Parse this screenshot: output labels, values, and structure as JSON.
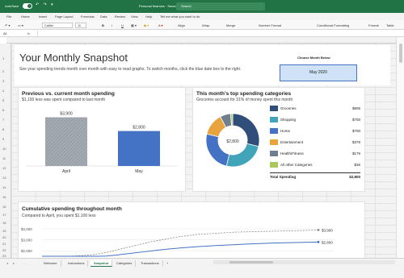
{
  "titlebar": {
    "autosave_label": "AutoSave",
    "autosave_state": "On",
    "doc_title": "Personal finances · Saved",
    "search_placeholder": "Search",
    "quick_access": "↶ ↷ ▾"
  },
  "menu": {
    "items": [
      "File",
      "Home",
      "Insert",
      "Page Layout",
      "Formulas",
      "Data",
      "Review",
      "View",
      "Help"
    ],
    "tell_me": "Tell me what you want to do"
  },
  "ribbon": {
    "font_name": "Calibri",
    "font_size": "11",
    "bold": "B",
    "italic": "I",
    "underline": "U",
    "align_label": "Align",
    "wrap_label": "Wrap",
    "merge_label": "Merge",
    "number_format": "Number Format",
    "cond_format": "Conditional Formatting",
    "format_label": "Format",
    "table_label": "Table"
  },
  "formula_bar": {
    "cell_ref": "A1",
    "fx": "fx",
    "value": ""
  },
  "row_numbers": [
    "1",
    "2",
    "3",
    "4",
    "5",
    "6",
    "7",
    "8",
    "9",
    "10",
    "11",
    "12",
    "13",
    "14",
    "15",
    "16",
    "17",
    "18",
    "19",
    "20",
    "21",
    "22",
    "23"
  ],
  "header": {
    "title": "Your Monthly Snapshot",
    "subtitle": "See your spending trends month over month with easy to read graphs. To switch months, click the blue date box to the right.",
    "choose_label": "Choose Month Below",
    "month_value": "May 2020"
  },
  "prev_vs_current": {
    "title": "Previous vs. current month spending",
    "subtitle": "$1,100 less was spent compared to last month"
  },
  "top_categories": {
    "title": "This month’s top spending categories",
    "subtitle": "Groceries account for 31% of money spent this month",
    "center_label": "$2,800",
    "total_label": "Total Spending",
    "total_value": "$2,800",
    "rows": [
      {
        "label": "Groceries",
        "value": "$806",
        "color": "#2f4e7a"
      },
      {
        "label": "Shopping",
        "value": "$700",
        "color": "#41a4b8"
      },
      {
        "label": "Home",
        "value": "$700",
        "color": "#4472c4"
      },
      {
        "label": "Entertainment",
        "value": "$379",
        "color": "#e8a33d"
      },
      {
        "label": "Health/Fitness",
        "value": "$179",
        "color": "#6f7f8f"
      },
      {
        "label": "All other Categories",
        "value": "$36",
        "color": "#a9c75a"
      }
    ]
  },
  "cumulative": {
    "title": "Cumulative spending throughout month",
    "subtitle": "Compared to April, you spent $1,100 less"
  },
  "chart_data": [
    {
      "type": "bar",
      "categories": [
        "April",
        "May"
      ],
      "values": [
        3900,
        2800
      ],
      "data_labels": [
        "$3,900",
        "$2,800"
      ],
      "ylim": [
        0,
        4000
      ]
    },
    {
      "type": "pie",
      "categories": [
        "Groceries",
        "Shopping",
        "Home",
        "Entertainment",
        "Health/Fitness",
        "All other Categories"
      ],
      "values": [
        806,
        700,
        700,
        379,
        179,
        36
      ],
      "center_label": "$2,800"
    },
    {
      "type": "line",
      "ytick_labels": [
        "$4,000",
        "$3,000",
        "$2,000"
      ],
      "ylim": [
        1500,
        4000
      ],
      "x": [
        0,
        1,
        2,
        3,
        4,
        5,
        6,
        7,
        8,
        9,
        10,
        11,
        12,
        13,
        14,
        15,
        16,
        17,
        18,
        19,
        20,
        21,
        22,
        23,
        24,
        25,
        26,
        27,
        28,
        29,
        30
      ],
      "series": [
        {
          "values": [
            1500,
            1500,
            1500,
            1500,
            1550,
            1600,
            1700,
            1850,
            2050,
            2250,
            2450,
            2650,
            2850,
            3000,
            3150,
            3300,
            3400,
            3500,
            3550,
            3600,
            3650,
            3700,
            3720,
            3740,
            3760,
            3780,
            3800,
            3820,
            3840,
            3870,
            3900
          ],
          "end_label": "$3,900",
          "style": "dashed",
          "color": "#8a8a8a"
        },
        {
          "values": [
            1500,
            1500,
            1500,
            1500,
            1500,
            1500,
            1500,
            1520,
            1600,
            1700,
            1800,
            1900,
            2000,
            2100,
            2180,
            2250,
            2320,
            2380,
            2430,
            2480,
            2520,
            2560,
            2600,
            2640,
            2670,
            2700,
            2720,
            2740,
            2760,
            2780,
            2800
          ],
          "end_label": "$2,800",
          "style": "solid",
          "color": "#4472c4"
        }
      ]
    }
  ],
  "sheet_tabs": [
    "Welcome",
    "Instructions",
    "Snapshot",
    "Categories",
    "Transactions"
  ],
  "active_tab": "Snapshot",
  "add_sheet": "+"
}
